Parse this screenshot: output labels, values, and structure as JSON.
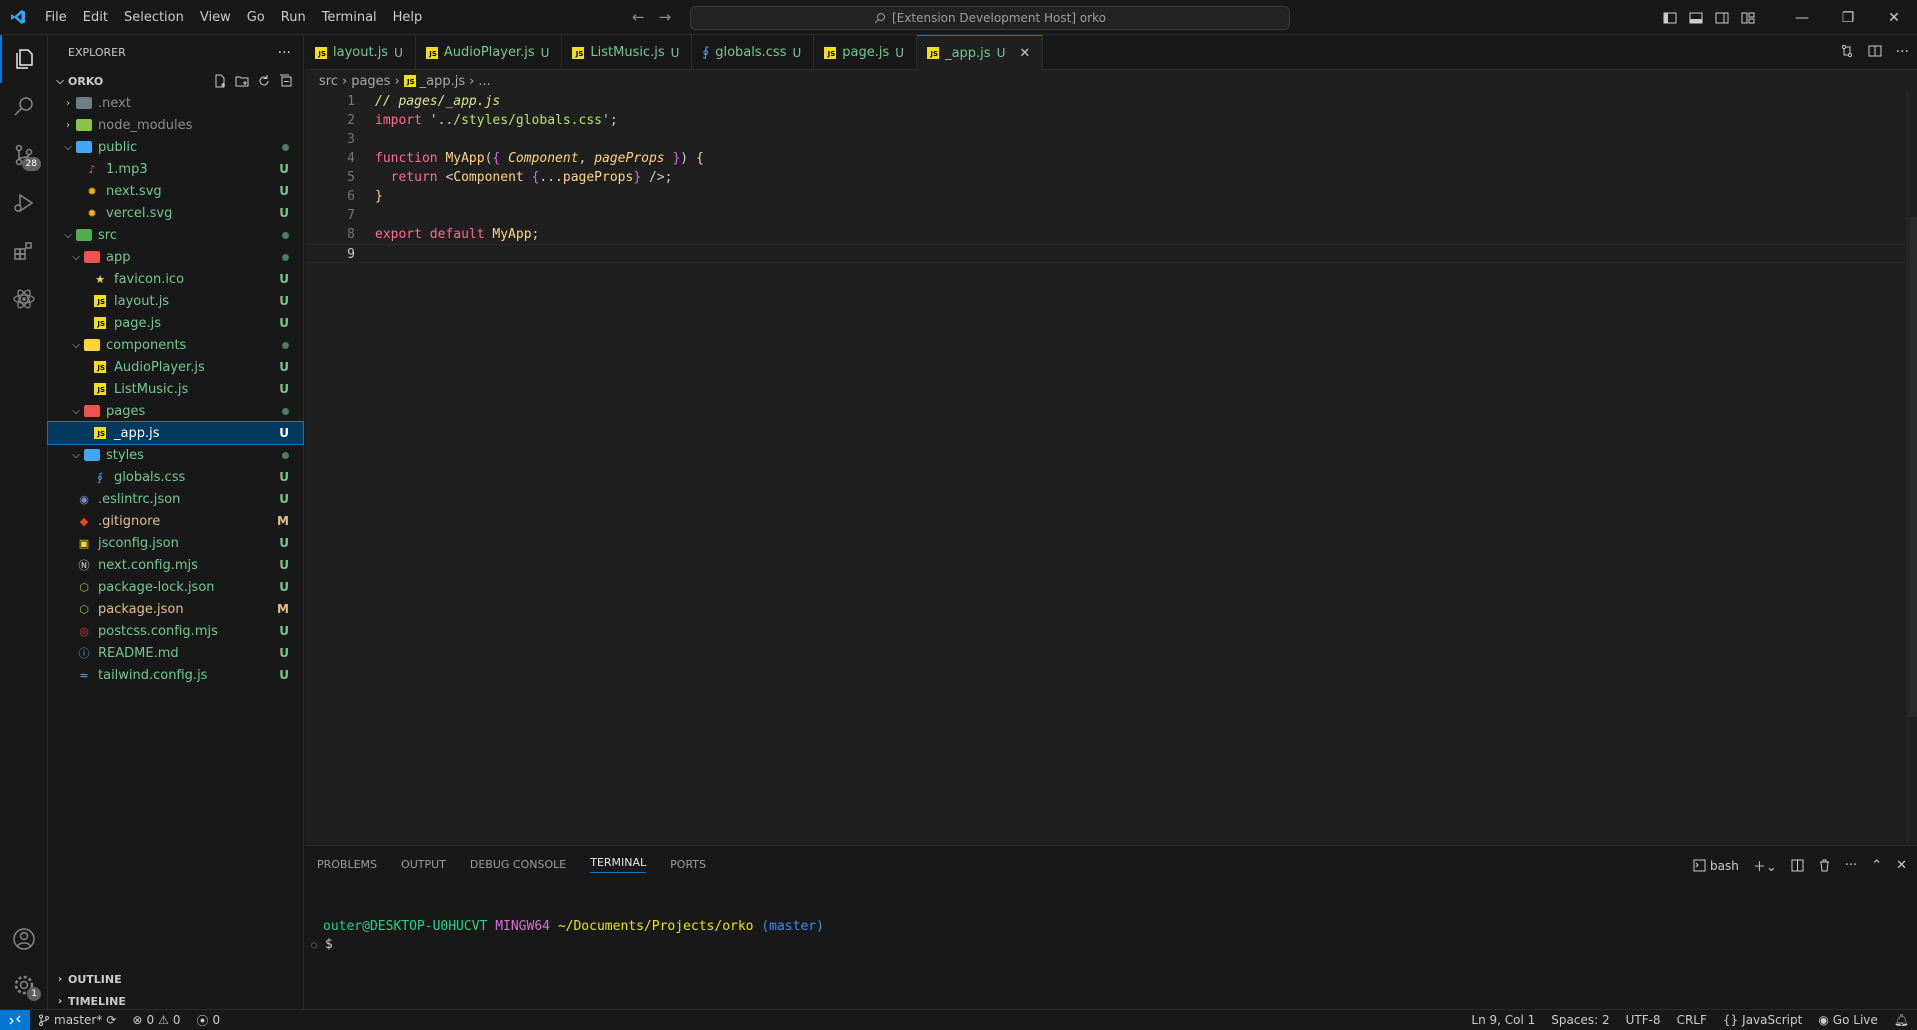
{
  "titlebar": {
    "menu": [
      "File",
      "Edit",
      "Selection",
      "View",
      "Go",
      "Run",
      "Terminal",
      "Help"
    ],
    "command_center": "[Extension Development Host] orko"
  },
  "activity_bar": {
    "scm_badge": "28",
    "settings_badge": "1"
  },
  "sidebar": {
    "title": "EXPLORER",
    "root": "ORKO",
    "tree": [
      {
        "label": ".next",
        "depth": 0,
        "type": "folder",
        "expanded": false,
        "color": "grey",
        "status": "",
        "icon": "folder-next-icon"
      },
      {
        "label": "node_modules",
        "depth": 0,
        "type": "folder",
        "expanded": false,
        "color": "grey",
        "status": "",
        "icon": "folder-node-icon"
      },
      {
        "label": "public",
        "depth": 0,
        "type": "folder",
        "expanded": true,
        "color": "green",
        "status": "dot",
        "icon": "folder-public-icon"
      },
      {
        "label": "1.mp3",
        "depth": 1,
        "type": "file",
        "color": "green",
        "status": "U",
        "icon": "audio-file-icon"
      },
      {
        "label": "next.svg",
        "depth": 1,
        "type": "file",
        "color": "green",
        "status": "U",
        "icon": "svg-file-icon"
      },
      {
        "label": "vercel.svg",
        "depth": 1,
        "type": "file",
        "color": "green",
        "status": "U",
        "icon": "svg-file-icon"
      },
      {
        "label": "src",
        "depth": 0,
        "type": "folder",
        "expanded": true,
        "color": "green",
        "status": "dot",
        "icon": "folder-src-icon"
      },
      {
        "label": "app",
        "depth": 1,
        "type": "folder",
        "expanded": true,
        "color": "green",
        "status": "dot",
        "icon": "folder-app-icon"
      },
      {
        "label": "favicon.ico",
        "depth": 2,
        "type": "file",
        "color": "green",
        "status": "U",
        "icon": "favicon-file-icon"
      },
      {
        "label": "layout.js",
        "depth": 2,
        "type": "file",
        "color": "green",
        "status": "U",
        "icon": "js-file-icon"
      },
      {
        "label": "page.js",
        "depth": 2,
        "type": "file",
        "color": "green",
        "status": "U",
        "icon": "js-file-icon"
      },
      {
        "label": "components",
        "depth": 1,
        "type": "folder",
        "expanded": true,
        "color": "green",
        "status": "dot",
        "icon": "folder-components-icon"
      },
      {
        "label": "AudioPlayer.js",
        "depth": 2,
        "type": "file",
        "color": "green",
        "status": "U",
        "icon": "js-file-icon"
      },
      {
        "label": "ListMusic.js",
        "depth": 2,
        "type": "file",
        "color": "green",
        "status": "U",
        "icon": "js-file-icon"
      },
      {
        "label": "pages",
        "depth": 1,
        "type": "folder",
        "expanded": true,
        "color": "green",
        "status": "dot",
        "icon": "folder-pages-icon"
      },
      {
        "label": "_app.js",
        "depth": 2,
        "type": "file",
        "color": "green",
        "status": "U",
        "icon": "js-file-icon",
        "selected": true
      },
      {
        "label": "styles",
        "depth": 1,
        "type": "folder",
        "expanded": true,
        "color": "green",
        "status": "dot",
        "icon": "folder-styles-icon"
      },
      {
        "label": "globals.css",
        "depth": 2,
        "type": "file",
        "color": "green",
        "status": "U",
        "icon": "css-file-icon"
      },
      {
        "label": ".eslintrc.json",
        "depth": 0,
        "type": "file",
        "color": "green",
        "status": "U",
        "icon": "eslint-file-icon"
      },
      {
        "label": ".gitignore",
        "depth": 0,
        "type": "file",
        "color": "yellow",
        "status": "M",
        "icon": "git-file-icon"
      },
      {
        "label": "jsconfig.json",
        "depth": 0,
        "type": "file",
        "color": "green",
        "status": "U",
        "icon": "jsconfig-file-icon"
      },
      {
        "label": "next.config.mjs",
        "depth": 0,
        "type": "file",
        "color": "green",
        "status": "U",
        "icon": "next-file-icon"
      },
      {
        "label": "package-lock.json",
        "depth": 0,
        "type": "file",
        "color": "green",
        "status": "U",
        "icon": "npm-file-icon"
      },
      {
        "label": "package.json",
        "depth": 0,
        "type": "file",
        "color": "yellow",
        "status": "M",
        "icon": "npm-file-icon"
      },
      {
        "label": "postcss.config.mjs",
        "depth": 0,
        "type": "file",
        "color": "green",
        "status": "U",
        "icon": "postcss-file-icon"
      },
      {
        "label": "README.md",
        "depth": 0,
        "type": "file",
        "color": "green",
        "status": "U",
        "icon": "info-file-icon"
      },
      {
        "label": "tailwind.config.js",
        "depth": 0,
        "type": "file",
        "color": "green",
        "status": "U",
        "icon": "tailwind-file-icon"
      }
    ],
    "outline_label": "OUTLINE",
    "timeline_label": "TIMELINE"
  },
  "tabs": [
    {
      "label": "layout.js",
      "status": "U",
      "type": "js",
      "active": false
    },
    {
      "label": "AudioPlayer.js",
      "status": "U",
      "type": "js",
      "active": false
    },
    {
      "label": "ListMusic.js",
      "status": "U",
      "type": "js",
      "active": false
    },
    {
      "label": "globals.css",
      "status": "U",
      "type": "css",
      "active": false
    },
    {
      "label": "page.js",
      "status": "U",
      "type": "js",
      "active": false
    },
    {
      "label": "_app.js",
      "status": "U",
      "type": "js",
      "active": true
    }
  ],
  "breadcrumb": {
    "parts": [
      "src",
      "pages",
      "_app.js",
      "..."
    ]
  },
  "editor": {
    "current_line": 9,
    "lines": [
      [
        {
          "t": "// pages/_app.js",
          "c": "k-comment"
        }
      ],
      [
        {
          "t": "import ",
          "c": "k-kw"
        },
        {
          "t": "'../styles/globals.css'",
          "c": "k-str"
        },
        {
          "t": ";",
          "c": "k-punc"
        }
      ],
      [],
      [
        {
          "t": "function ",
          "c": "k-kw"
        },
        {
          "t": "MyApp",
          "c": "k-fn"
        },
        {
          "t": "(",
          "c": "k-punc"
        },
        {
          "t": "{ ",
          "c": "k-brace"
        },
        {
          "t": "Component",
          "c": "k-param"
        },
        {
          "t": ", ",
          "c": "k-punc"
        },
        {
          "t": "pageProps",
          "c": "k-param"
        },
        {
          "t": " }",
          "c": "k-brace"
        },
        {
          "t": ") ",
          "c": "k-punc"
        },
        {
          "t": "{",
          "c": "k-fn"
        }
      ],
      [
        {
          "t": "  return ",
          "c": "k-kw"
        },
        {
          "t": "<",
          "c": "k-punc"
        },
        {
          "t": "Component",
          "c": "k-tag"
        },
        {
          "t": " ",
          "c": "k-punc"
        },
        {
          "t": "{",
          "c": "k-brace"
        },
        {
          "t": "...pageProps",
          "c": "k-ident"
        },
        {
          "t": "}",
          "c": "k-brace"
        },
        {
          "t": " />;",
          "c": "k-punc"
        }
      ],
      [
        {
          "t": "}",
          "c": "k-fn"
        }
      ],
      [],
      [
        {
          "t": "export default ",
          "c": "k-kw"
        },
        {
          "t": "MyApp",
          "c": "k-fn"
        },
        {
          "t": ";",
          "c": "k-punc"
        }
      ],
      []
    ]
  },
  "panel": {
    "tabs": [
      "PROBLEMS",
      "OUTPUT",
      "DEBUG CONSOLE",
      "TERMINAL",
      "PORTS"
    ],
    "active_tab": "TERMINAL",
    "shell": "bash",
    "prompt_user": "outer@DESKTOP-U0HUCVT",
    "prompt_host": "MINGW64",
    "prompt_path": "~/Documents/Projects/orko",
    "prompt_branch": "(master)",
    "prompt_symbol": "$"
  },
  "statusbar": {
    "branch": "master*",
    "errors": "0",
    "warnings": "0",
    "ports": "0",
    "position": "Ln 9, Col 1",
    "spaces": "Spaces: 2",
    "encoding": "UTF-8",
    "eol": "CRLF",
    "language": "JavaScript",
    "golive": "Go Live"
  },
  "colors": {
    "accent": "#0078d4",
    "untracked": "#73c991",
    "modified": "#e2c08d"
  }
}
